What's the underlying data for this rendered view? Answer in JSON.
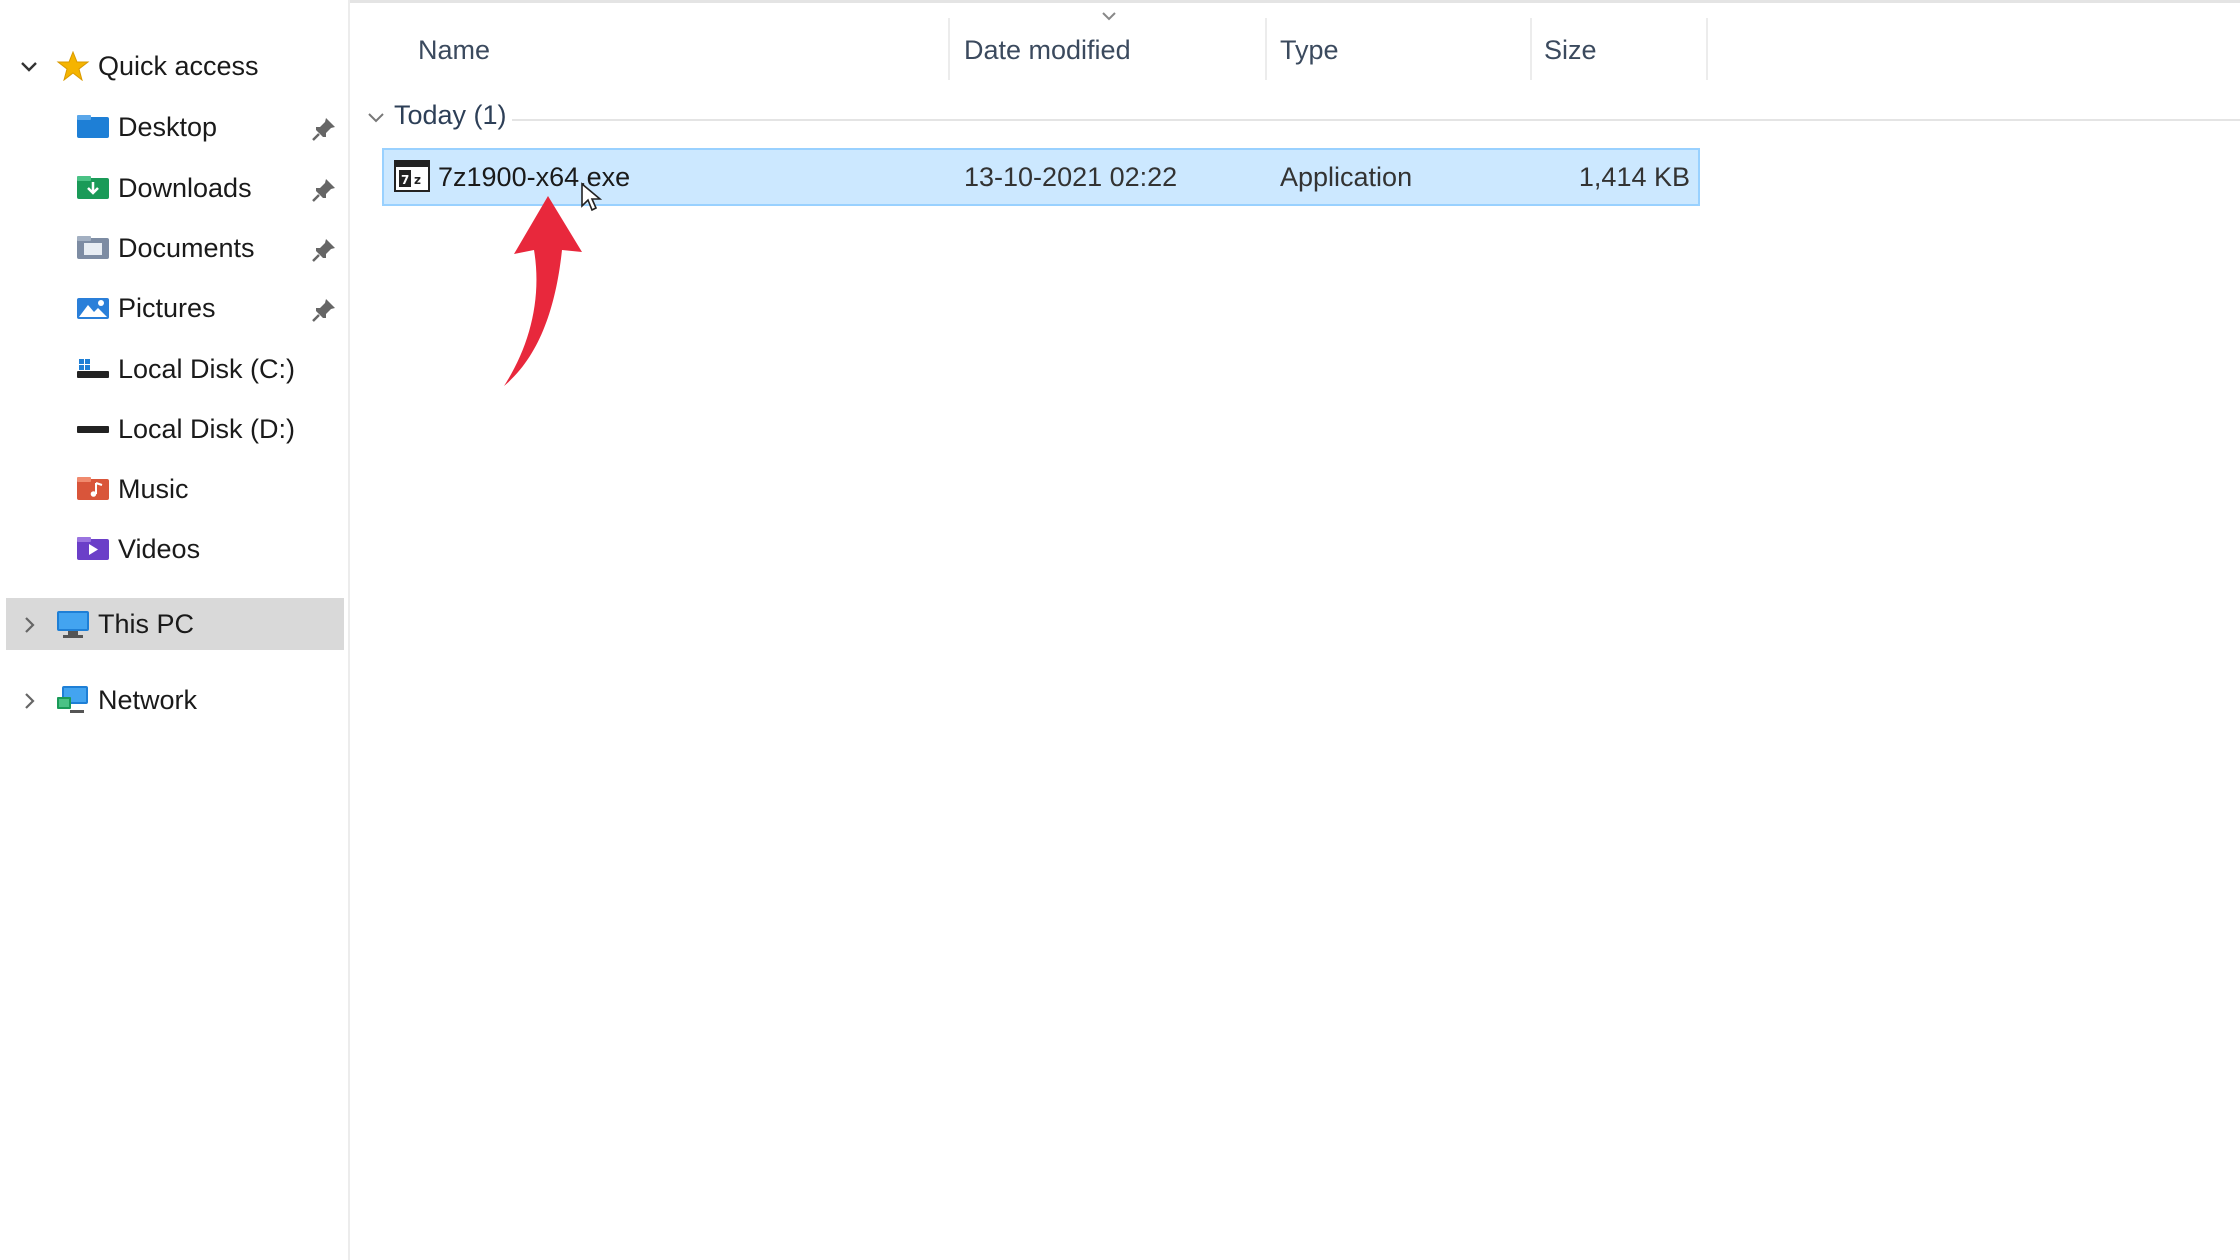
{
  "nav": {
    "quick_access": "Quick access",
    "items": [
      {
        "label": "Desktop",
        "icon": "desktop-icon",
        "pinned": true
      },
      {
        "label": "Downloads",
        "icon": "downloads-icon",
        "pinned": true
      },
      {
        "label": "Documents",
        "icon": "documents-icon",
        "pinned": true
      },
      {
        "label": "Pictures",
        "icon": "pictures-icon",
        "pinned": true
      },
      {
        "label": "Local Disk (C:)",
        "icon": "local-disk-c-icon",
        "pinned": false
      },
      {
        "label": "Local Disk (D:)",
        "icon": "local-disk-d-icon",
        "pinned": false
      },
      {
        "label": "Music",
        "icon": "music-icon",
        "pinned": false
      },
      {
        "label": "Videos",
        "icon": "videos-icon",
        "pinned": false
      }
    ],
    "this_pc": "This PC",
    "network": "Network"
  },
  "columns": {
    "name": "Name",
    "date_modified": "Date modified",
    "type": "Type",
    "size": "Size"
  },
  "group": {
    "label": "Today (1)"
  },
  "files": [
    {
      "name": "7z1900-x64.exe",
      "date": "13-10-2021 02:22",
      "type": "Application",
      "size": "1,414 KB",
      "selected": true
    }
  ],
  "colors": {
    "selection_fill": "#cce8ff",
    "selection_border": "#99d1ff",
    "annotation_arrow": "#e8283c",
    "nav_selected": "#d9d9d9"
  }
}
